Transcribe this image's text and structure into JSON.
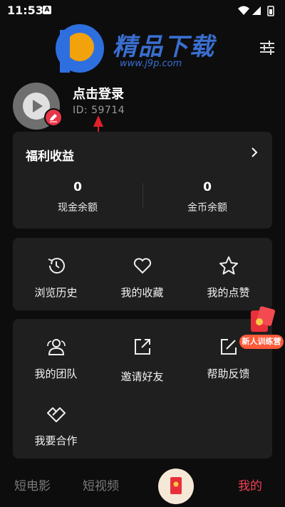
{
  "status_bar": {
    "time": "11:53",
    "notif_glyph": "A"
  },
  "watermark": {
    "brand": "精品下载",
    "url": "www.j9p.com"
  },
  "profile": {
    "login_label": "点击登录",
    "user_id": "ID: 59714"
  },
  "welfare": {
    "title": "福利收益",
    "stats": [
      {
        "value": "0",
        "label": "现金余额"
      },
      {
        "value": "0",
        "label": "金币余额"
      }
    ]
  },
  "shortcuts": [
    {
      "label": "浏览历史",
      "icon": "history-icon"
    },
    {
      "label": "我的收藏",
      "icon": "heart-icon"
    },
    {
      "label": "我的点赞",
      "icon": "star-icon"
    }
  ],
  "services": [
    {
      "label": "我的团队",
      "icon": "team-icon"
    },
    {
      "label": "邀请好友",
      "icon": "share-icon"
    },
    {
      "label": "帮助反馈",
      "icon": "feedback-icon"
    },
    {
      "label": "我要合作",
      "icon": "handshake-icon"
    }
  ],
  "promo": {
    "label": "新人训练营"
  },
  "bottom_nav": [
    {
      "label": "短电影",
      "active": false
    },
    {
      "label": "短视频",
      "active": false
    },
    {
      "label": "我的",
      "active": true
    }
  ],
  "colors": {
    "accent": "#f04052",
    "card": "#1f1f1f",
    "background": "#0d0d0d",
    "edit_badge": "#e9364a"
  }
}
